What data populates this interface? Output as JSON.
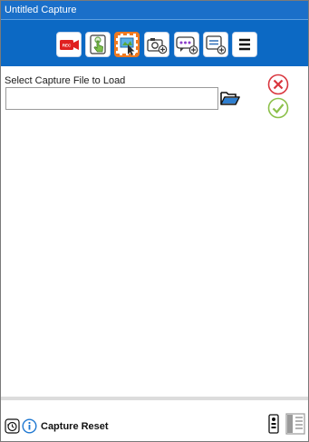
{
  "window": {
    "title": "Untitled Capture"
  },
  "toolbar": {
    "buttons": [
      {
        "name": "record-button",
        "icon": "rec-camera-icon",
        "badge": "REC",
        "selected": false
      },
      {
        "name": "touch-capture-button",
        "icon": "touch-pointer-icon",
        "selected": false
      },
      {
        "name": "select-region-button",
        "icon": "region-select-icon",
        "selected": true
      },
      {
        "name": "screenshot-button",
        "icon": "camera-add-icon",
        "selected": false
      },
      {
        "name": "message-button",
        "icon": "message-add-icon",
        "selected": false
      },
      {
        "name": "note-button",
        "icon": "note-add-icon",
        "selected": false
      },
      {
        "name": "menu-button",
        "icon": "hamburger-menu-icon",
        "selected": false
      }
    ]
  },
  "load": {
    "label": "Select Capture File to Load",
    "value": "",
    "placeholder": ""
  },
  "status": {
    "text": "Capture Reset"
  },
  "colors": {
    "title_bar": "#1a6fc9",
    "toolbar": "#0c69c4",
    "selected_outline": "#f07a20",
    "cancel": "#d9363e",
    "confirm": "#8cc04a"
  }
}
